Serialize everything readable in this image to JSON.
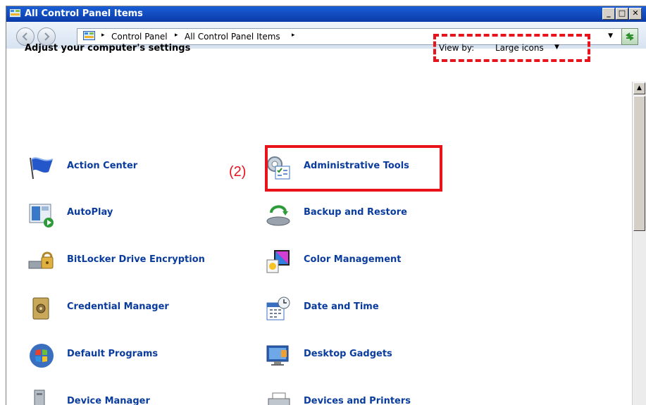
{
  "window": {
    "title": "All Control Panel Items",
    "buttons": {
      "minimize": "_",
      "maximize": "□",
      "close": "✕"
    }
  },
  "address": {
    "breadcrumbs": [
      "Control Panel",
      "All Control Panel Items"
    ],
    "separator": "▸"
  },
  "content": {
    "heading": "Adjust your computer's settings",
    "view_by_label": "View by:",
    "view_by_value": "Large icons"
  },
  "annotation": {
    "step_label": "(2)",
    "color": "#e8131b"
  },
  "items_left": [
    {
      "label": "Action Center",
      "icon": "flag-icon"
    },
    {
      "label": "AutoPlay",
      "icon": "autoplay-icon"
    },
    {
      "label": "BitLocker Drive Encryption",
      "icon": "bitlocker-icon"
    },
    {
      "label": "Credential Manager",
      "icon": "vault-icon"
    },
    {
      "label": "Default Programs",
      "icon": "windows-globe-icon"
    },
    {
      "label": "Device Manager",
      "icon": "device-manager-icon"
    }
  ],
  "items_right": [
    {
      "label": "Administrative Tools",
      "icon": "admin-tools-icon"
    },
    {
      "label": "Backup and Restore",
      "icon": "backup-icon"
    },
    {
      "label": "Color Management",
      "icon": "color-management-icon"
    },
    {
      "label": "Date and Time",
      "icon": "calendar-clock-icon"
    },
    {
      "label": "Desktop Gadgets",
      "icon": "gadgets-icon"
    },
    {
      "label": "Devices and Printers",
      "icon": "printer-icon"
    }
  ],
  "colors": {
    "link_text": "#0a3c9e",
    "titlebar": "#0a3aa8",
    "annotation": "#e8131b"
  }
}
